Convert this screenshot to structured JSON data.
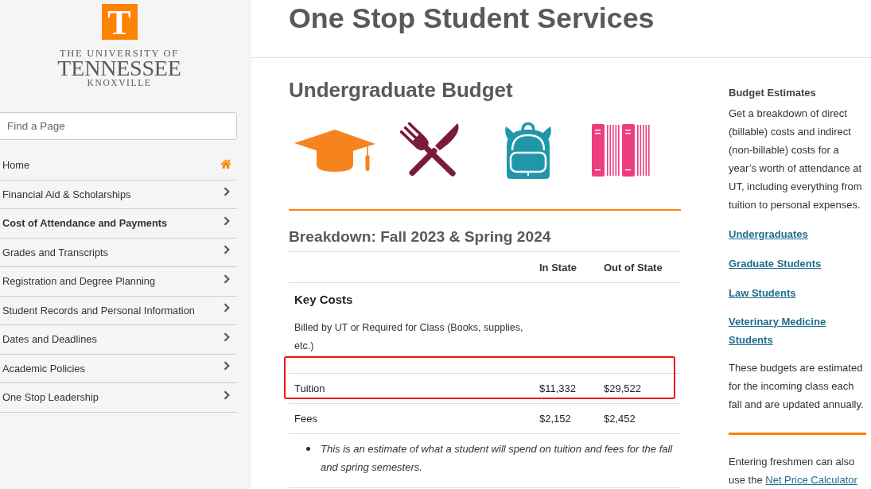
{
  "sidebar": {
    "logo": {
      "mark": "T",
      "line_1": "THE UNIVERSITY OF",
      "line_2": "TENNESSEE",
      "line_3": "KNOXVILLE"
    },
    "search": {
      "placeholder": "Find a Page"
    },
    "nav_items": [
      {
        "label": "Home",
        "kind": "home",
        "selected": false
      },
      {
        "label": "Financial Aid & Scholarships",
        "kind": "section",
        "selected": false
      },
      {
        "label": "Cost of Attendance and Payments",
        "kind": "section",
        "selected": true
      },
      {
        "label": "Grades and Transcripts",
        "kind": "section",
        "selected": false
      },
      {
        "label": "Registration and Degree Planning",
        "kind": "section",
        "selected": false
      },
      {
        "label": "Student Records and Personal Information",
        "kind": "section",
        "selected": false
      },
      {
        "label": "Dates and Deadlines",
        "kind": "section",
        "selected": false
      },
      {
        "label": "Academic Policies",
        "kind": "section",
        "selected": false
      },
      {
        "label": "One Stop Leadership",
        "kind": "section",
        "selected": false
      }
    ]
  },
  "header": {
    "title": "One Stop Student Services"
  },
  "content": {
    "title": "Undergraduate Budget",
    "breakdown": {
      "title": "Breakdown: Fall 2023 & Spring 2024",
      "columns": [
        "In State",
        "Out of State"
      ],
      "rows": [
        {
          "kind": "heading",
          "label": "Key Costs"
        },
        {
          "kind": "note",
          "label": "Billed by UT or Required for Class (Books, supplies, etc.)"
        },
        {
          "kind": "cost",
          "label": "Tuition",
          "in_state": "$11,332",
          "out_of_state": "$29,522",
          "highlighted": true
        },
        {
          "kind": "cost",
          "label": "Fees",
          "in_state": "$2,152",
          "out_of_state": "$2,452",
          "highlighted": false
        },
        {
          "kind": "bullet",
          "label": "This is an estimate of what a student will spend on tuition and fees for the fall and spring semesters."
        }
      ]
    }
  },
  "aside": {
    "title": "Budget Estimates",
    "intro": "Get a breakdown of direct (billable) costs and indirect (non-billable) costs for a year’s worth of attendance at UT, including everything from tuition to personal expenses.",
    "links": [
      "Undergraduates",
      "Graduate Students",
      "Law Students",
      "Veterinary Medicine Students"
    ],
    "note": "These budgets are estimated for the incoming class each fall and are updated annually.",
    "footer": {
      "text": "Entering freshmen can also use the",
      "link": "Net Price Calculator"
    }
  }
}
